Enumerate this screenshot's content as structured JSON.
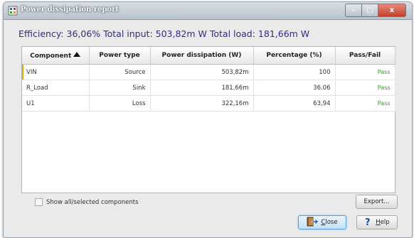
{
  "window": {
    "title": "Power dissipation report",
    "controls": {
      "minimize": "–",
      "maximize": "□",
      "close": "x"
    }
  },
  "summary": "Efficiency: 36,06% Total input: 503,82m W Total load: 181,66m W",
  "table": {
    "columns": [
      "Component",
      "Power type",
      "Power dissipation (W)",
      "Percentage (%)",
      "Pass/Fail"
    ],
    "sorted_column": "Component",
    "rows": [
      [
        "VIN",
        "Source",
        "503,82m",
        "100",
        "Pass"
      ],
      [
        "R_Load",
        "Sink",
        "181,66m",
        "36.06",
        "Pass"
      ],
      [
        "U1",
        "Loss",
        "322,16m",
        "63,94",
        "Pass"
      ]
    ]
  },
  "show_all_label": "Show all/selected components",
  "show_all_checked": false,
  "buttons": {
    "export": "Export...",
    "close_first": "C",
    "close_rest": "lose",
    "help_first": "H",
    "help_rest": "elp"
  },
  "colors": {
    "summary_text": "#2d2d88",
    "pass_text": "#3a9a2e",
    "selected_row_marker": "#e0a800",
    "close_button_accent": "#5d9ed8"
  },
  "icons": [
    "app-icon",
    "sort-ascending-icon",
    "close-door-icon",
    "help-question-icon"
  ]
}
